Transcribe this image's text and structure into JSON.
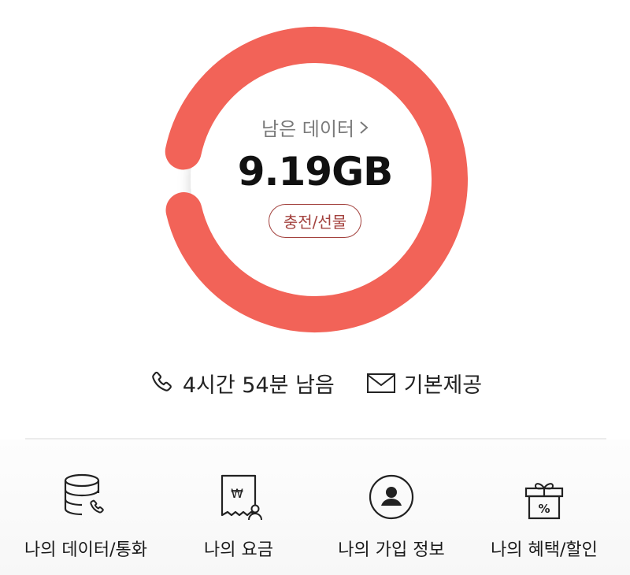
{
  "usage": {
    "remaining_label": "남은 데이터",
    "remaining_amount": "9.19GB",
    "remaining_fraction": 0.93,
    "charge_gift_label": "충전/선물",
    "ring_color": "#f26358"
  },
  "info": {
    "call_remaining": "4시간 54분 남음",
    "sms_label": "기본제공"
  },
  "menu": [
    {
      "label": "나의 데이터/통화",
      "icon": "database-phone-icon"
    },
    {
      "label": "나의 요금",
      "icon": "won-receipt-icon"
    },
    {
      "label": "나의 가입 정보",
      "icon": "user-circle-icon"
    },
    {
      "label": "나의 혜택/할인",
      "icon": "gift-percent-icon"
    }
  ]
}
